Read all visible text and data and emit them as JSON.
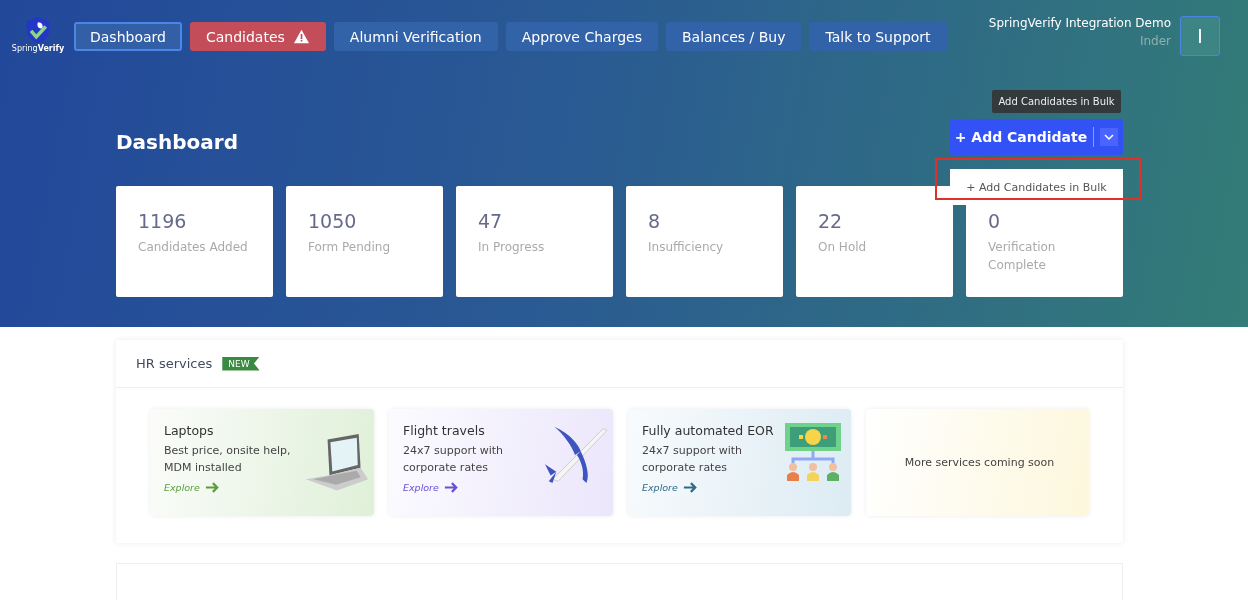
{
  "logo": {
    "text_a": "Spring",
    "text_b": "Verify"
  },
  "nav": [
    {
      "label": "Dashboard",
      "selected": true,
      "alert": false
    },
    {
      "label": "Candidates",
      "selected": false,
      "alert": true
    },
    {
      "label": "Alumni Verification",
      "selected": false,
      "alert": false
    },
    {
      "label": "Approve Charges",
      "selected": false,
      "alert": false
    },
    {
      "label": "Balances / Buy",
      "selected": false,
      "alert": false
    },
    {
      "label": "Talk to Support",
      "selected": false,
      "alert": false
    }
  ],
  "account": {
    "company": "SpringVerify Integration Demo",
    "user": "Inder",
    "avatar": "I"
  },
  "page_title": "Dashboard",
  "add_button": {
    "label": "+ Add Candidate",
    "tooltip": "Add Candidates in Bulk",
    "menu_item": "+ Add Candidates in Bulk",
    "expanded": true
  },
  "stats": [
    {
      "value": "1196",
      "label": "Candidates Added"
    },
    {
      "value": "1050",
      "label": "Form Pending"
    },
    {
      "value": "47",
      "label": "In Progress"
    },
    {
      "value": "8",
      "label": "Insufficiency"
    },
    {
      "value": "22",
      "label": "On Hold"
    },
    {
      "value": "0",
      "label": "Verification Complete"
    }
  ],
  "hr_services": {
    "title": "HR services",
    "badge": "NEW",
    "cards": [
      {
        "kind": "laptop",
        "title": "Laptops",
        "text": "Best price, onsite help, MDM installed",
        "link": "Explore",
        "color": "#5a9e3a"
      },
      {
        "kind": "flight",
        "title": "Flight travels",
        "text": "24x7 support with corporate rates",
        "link": "Explore",
        "color": "#6a4fd6"
      },
      {
        "kind": "eor",
        "title": "Fully automated EOR",
        "text": "24x7 support with corporate rates",
        "link": "Explore",
        "color": "#2f6a86"
      },
      {
        "kind": "soon",
        "text": "More services coming soon",
        "color": "#fdf7dc"
      }
    ]
  }
}
